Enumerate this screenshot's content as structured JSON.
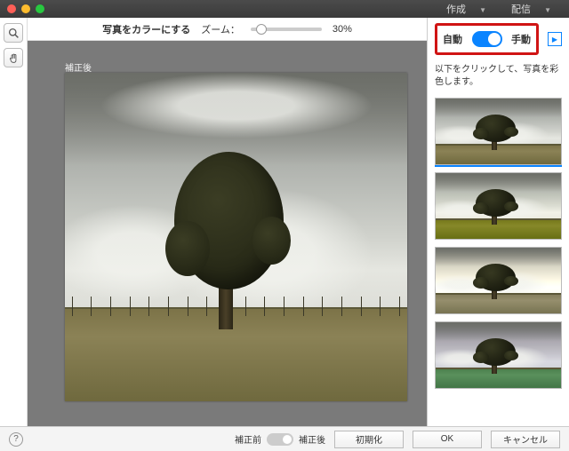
{
  "menu": {
    "create": "作成",
    "distribute": "配信"
  },
  "header": {
    "title": "写真をカラーにする",
    "zoom_label": "ズーム：",
    "zoom_value": "30%"
  },
  "tools": {
    "zoom": "zoom-icon",
    "hand": "hand-icon"
  },
  "stage": {
    "after_label": "補正後"
  },
  "side": {
    "mode_auto": "自動",
    "mode_manual": "手動",
    "instruction": "以下をクリックして、写真を彩色します。"
  },
  "footer": {
    "before": "補正前",
    "after": "補正後",
    "reset": "初期化",
    "ok": "OK",
    "cancel": "キャンセル"
  }
}
